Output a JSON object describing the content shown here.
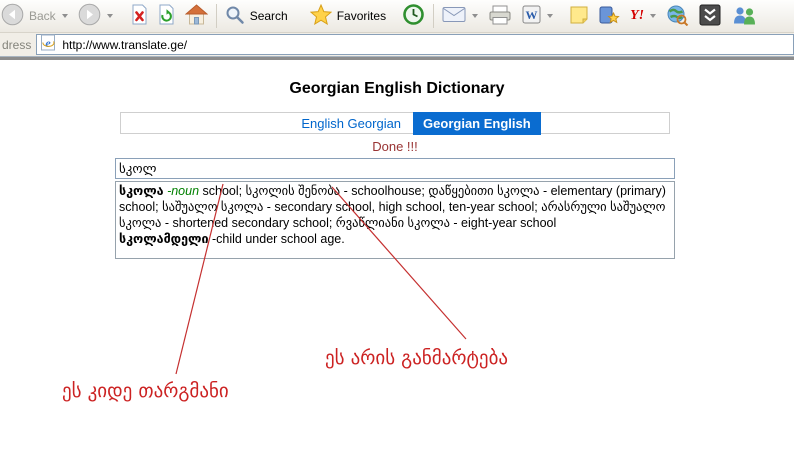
{
  "browser": {
    "toolbar": {
      "back_label": "Back",
      "search_label": "Search",
      "favorites_label": "Favorites",
      "word_glyph": "W",
      "yahoo_glyph": "Y!"
    },
    "address": {
      "label": "dress",
      "url": "http://www.translate.ge/",
      "ie_glyph": "e"
    }
  },
  "page": {
    "title": "Georgian English Dictionary",
    "tabs": [
      {
        "label": "English Georgian",
        "active": false
      },
      {
        "label": "Georgian English",
        "active": true
      }
    ],
    "status": "Done !!!",
    "search_value": "სკოლ",
    "entries": [
      {
        "headword": "სკოლა",
        "pos": " -noun",
        "body": " school; სკოლის შენობა - schoolhouse; დაწყებითი სკოლა - elementary (primary) school; საშუალო სკოლა - secondary school, high school, ten-year school; არასრული საშუალო სკოლა - shortened secondary school; რვაწლიანი სკოლა - eight-year school"
      },
      {
        "headword": "სკოლამდელი",
        "pos": "",
        "body": " -child under school age."
      }
    ],
    "annotations": [
      {
        "text": "ეს არის განმარტება"
      },
      {
        "text": "ეს კიდე თარგმანი"
      }
    ]
  },
  "colors": {
    "active_tab_bg": "#0a6cd0",
    "link_blue": "#0066cc",
    "status_red": "#993333",
    "annotation_red": "#cc2222",
    "pos_green": "#008000"
  }
}
